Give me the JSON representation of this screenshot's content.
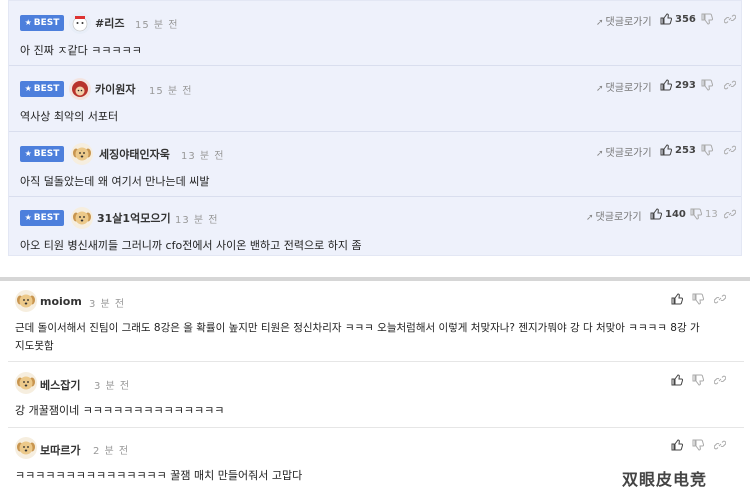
{
  "best_comments": [
    {
      "badge": "BEST",
      "name": "#리즈",
      "time": "15 분 전",
      "text": "아 진짜 ㅈ같다 ㅋㅋㅋㅋㅋ",
      "reply": "댓글로가기",
      "likes": "356",
      "avatar": "white-cat"
    },
    {
      "badge": "BEST",
      "name": "카이원자",
      "time": "15 분 전",
      "text": "역사상 최악의 서포터",
      "reply": "댓글로가기",
      "likes": "293",
      "avatar": "red-character"
    },
    {
      "badge": "BEST",
      "name": "세징야태인자욱",
      "time": "13 분 전",
      "text": "아직 덜돌았는데 왜 여기서 만나는데 씨발",
      "reply": "댓글로가기",
      "likes": "253",
      "avatar": "dog"
    },
    {
      "badge": "BEST",
      "name": "31살1억모으기",
      "time": "13 분 전",
      "text": "아오 티원 병신새끼들 그러니까 cfo전에서 사이온 밴하고 전력으로 하지 좀",
      "reply": "댓글로가기",
      "likes": "140",
      "dislikes": "13",
      "avatar": "dog"
    }
  ],
  "comments": [
    {
      "name": "moiom",
      "time": "3 분 전",
      "text_line1": "근데 돌이서해서 진팀이 그래도 8강은 올 확률이 높지만 티원은 정신차리자 ㅋㅋㅋ 오늘처럼해서 이렇게 처맞자나? 젠지가뭐야 강 다 처맞아 ㅋㅋㅋㅋ 8강 가",
      "text_line2": "지도못함",
      "avatar": "dog"
    },
    {
      "name": "베스잡기",
      "time": "3 분 전",
      "text_line1": "강 개꿀잼이네 ㅋㅋㅋㅋㅋㅋㅋㅋㅋㅋㅋㅋㅋㅋ",
      "avatar": "dog"
    },
    {
      "name": "보따르가",
      "time": "2 분 전",
      "text_line1": "ㅋㅋㅋㅋㅋㅋㅋㅋㅋㅋㅋㅋㅋㅋㅋ 꿀잼 매치 만들어줘서 고맙다",
      "avatar": "dog"
    }
  ],
  "watermark": "双眼皮电竞",
  "colors": {
    "best_badge": "#4d7fdc",
    "best_bg": "#eef1fb",
    "divider": "#d6d6d6"
  }
}
